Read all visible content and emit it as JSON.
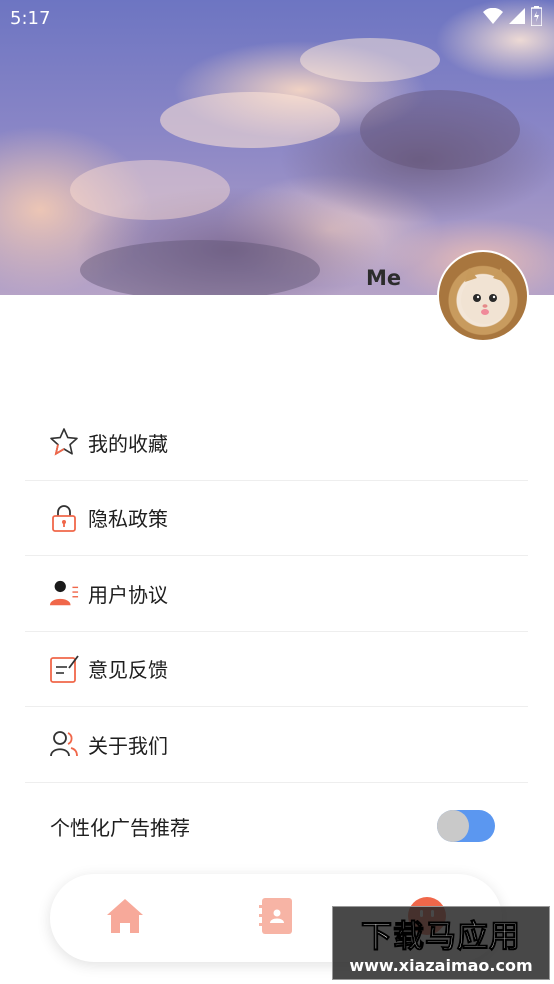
{
  "status_bar": {
    "time": "5:17"
  },
  "profile": {
    "name": "Me"
  },
  "menu": [
    {
      "label": "我的收藏",
      "icon": "star-icon"
    },
    {
      "label": "隐私政策",
      "icon": "lock-icon"
    },
    {
      "label": "用户协议",
      "icon": "user-agreement-icon"
    },
    {
      "label": "意见反馈",
      "icon": "feedback-edit-icon"
    },
    {
      "label": "关于我们",
      "icon": "people-icon"
    }
  ],
  "ad_setting": {
    "label": "个性化广告推荐",
    "enabled": true
  },
  "bottom_nav": [
    {
      "icon": "home-icon"
    },
    {
      "icon": "contacts-book-icon"
    },
    {
      "icon": "profile-face-icon"
    }
  ],
  "watermark": {
    "title": "下载马应用",
    "url": "www.xiazaimao.com"
  },
  "colors": {
    "accent": "#f0674a",
    "toggle_on": "#5b97f0"
  }
}
